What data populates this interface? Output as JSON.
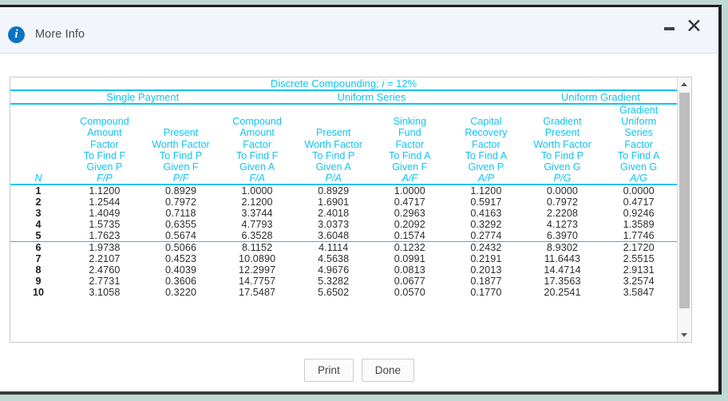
{
  "window": {
    "title": "More Info",
    "info_icon": "info-circle-icon",
    "minimize_label": "–",
    "close_label": "✕"
  },
  "table": {
    "caption_prefix": "Discrete Compounding; ",
    "caption_var": "i",
    "caption_suffix": " = 12%",
    "groups": [
      {
        "label": "Single Payment",
        "span": 2
      },
      {
        "label": "Uniform Series",
        "span": 4
      },
      {
        "label": "Uniform Gradient",
        "span": 2
      }
    ],
    "n_header": "N",
    "columns": [
      {
        "name": [
          "Compound",
          "Amount",
          "Factor"
        ],
        "find": "To Find F",
        "given": "Given P",
        "formula": "F/P"
      },
      {
        "name": [
          "Present",
          "Worth Factor"
        ],
        "find": "To Find P",
        "given": "Given F",
        "formula": "P/F"
      },
      {
        "name": [
          "Compound",
          "Amount",
          "Factor"
        ],
        "find": "To Find F",
        "given": "Given A",
        "formula": "F/A"
      },
      {
        "name": [
          "Present",
          "Worth Factor"
        ],
        "find": "To Find P",
        "given": "Given A",
        "formula": "P/A"
      },
      {
        "name": [
          "Sinking",
          "Fund",
          "Factor"
        ],
        "find": "To Find A",
        "given": "Given F",
        "formula": "A/F"
      },
      {
        "name": [
          "Capital",
          "Recovery",
          "Factor"
        ],
        "find": "To Find A",
        "given": "Given P",
        "formula": "A/P"
      },
      {
        "name": [
          "Gradient",
          "Present",
          "Worth Factor"
        ],
        "find": "To Find P",
        "given": "Given G",
        "formula": "P/G"
      },
      {
        "name": [
          "Gradient",
          "Uniform",
          "Series",
          "Factor"
        ],
        "find": "To Find A",
        "given": "Given G",
        "formula": "A/G"
      }
    ],
    "rows": [
      {
        "n": "1",
        "v": [
          "1.1200",
          "0.8929",
          "1.0000",
          "0.8929",
          "1.0000",
          "1.1200",
          "0.0000",
          "0.0000"
        ]
      },
      {
        "n": "2",
        "v": [
          "1.2544",
          "0.7972",
          "2.1200",
          "1.6901",
          "0.4717",
          "0.5917",
          "0.7972",
          "0.4717"
        ]
      },
      {
        "n": "3",
        "v": [
          "1.4049",
          "0.7118",
          "3.3744",
          "2.4018",
          "0.2963",
          "0.4163",
          "2.2208",
          "0.9246"
        ]
      },
      {
        "n": "4",
        "v": [
          "1.5735",
          "0.6355",
          "4.7793",
          "3.0373",
          "0.2092",
          "0.3292",
          "4.1273",
          "1.3589"
        ]
      },
      {
        "n": "5",
        "v": [
          "1.7623",
          "0.5674",
          "6.3528",
          "3.6048",
          "0.1574",
          "0.2774",
          "6.3970",
          "1.7746"
        ]
      },
      {
        "n": "6",
        "v": [
          "1.9738",
          "0.5066",
          "8.1152",
          "4.1114",
          "0.1232",
          "0.2432",
          "8.9302",
          "2.1720"
        ]
      },
      {
        "n": "7",
        "v": [
          "2.2107",
          "0.4523",
          "10.0890",
          "4.5638",
          "0.0991",
          "0.2191",
          "11.6443",
          "2.5515"
        ]
      },
      {
        "n": "8",
        "v": [
          "2.4760",
          "0.4039",
          "12.2997",
          "4.9676",
          "0.0813",
          "0.2013",
          "14.4714",
          "2.9131"
        ]
      },
      {
        "n": "9",
        "v": [
          "2.7731",
          "0.3606",
          "14.7757",
          "5.3282",
          "0.0677",
          "0.1877",
          "17.3563",
          "3.2574"
        ]
      },
      {
        "n": "10",
        "v": [
          "3.1058",
          "0.3220",
          "17.5487",
          "5.6502",
          "0.0570",
          "0.1770",
          "20.2541",
          "3.5847"
        ]
      }
    ],
    "band_after_row_index": 4
  },
  "scrollbar": {
    "up_arrow": "triangle-up-icon",
    "down_arrow": "triangle-down-icon"
  },
  "footer": {
    "print_label": "Print",
    "done_label": "Done"
  },
  "colors": {
    "accent_cyan": "#14c3f0",
    "info_blue": "#0c72c4",
    "titlebar_bg": "#f2f6fc",
    "frame": "#231f20",
    "desktop": "#bfd8d2"
  }
}
